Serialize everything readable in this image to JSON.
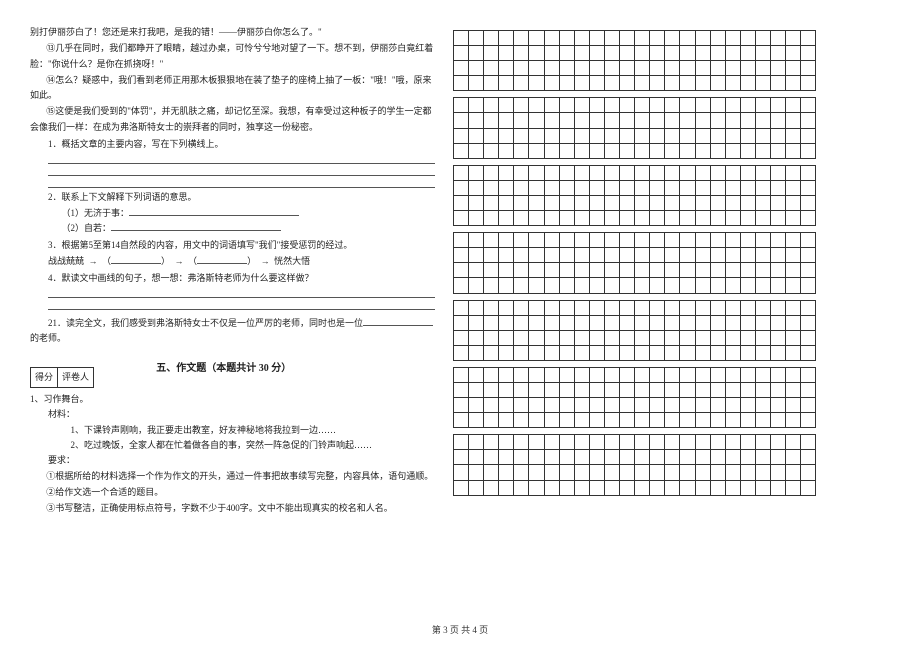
{
  "passage": {
    "p0": "别打伊丽莎白了！您还是来打我吧，是我的错！——伊丽莎白你怎么了。\"",
    "p1": "⑬几乎在同时，我们都睁开了眼睛，越过办桌，可怜兮兮地对望了一下。想不到，伊丽莎白竟红着脸：\"你说什么？是你在抓挠呀！\"",
    "p2": "⑭怎么？疑惑中，我们看到老师正用那木板狠狠地在装了垫子的座椅上抽了一板：\"哦！\"哦，原来如此。",
    "p3": "⑮这便是我们受到的\"体罚\"，并无肌肤之痛，却记忆至深。我想，有幸受过这种板子的学生一定都会像我们一样：在成为弗洛斯特女士的崇拜者的同时，独享这一份秘密。"
  },
  "questions": {
    "q1": "1．概括文章的主要内容，写在下列横线上。",
    "q2": "2．联系上下文解释下列词语的意思。",
    "q2a": "（1）无济于事：",
    "q2b": "（2）自若：",
    "q3": "3．根据第5至第14自然段的内容，用文中的词语填写\"我们\"接受惩罚的经过。",
    "q3_flow_a": "战战兢兢",
    "q3_flow_b": "恍然大悟",
    "arrow": "→",
    "lparen": "（",
    "rparen": "）",
    "q4": "4．默读文中画线的句子，想一想：弗洛斯特老师为什么要这样做？",
    "q21a": "21．读完全文，我们感受到弗洛斯特女士不仅是一位严厉的老师，同时也是一位",
    "q21b": "的老师。"
  },
  "section5": {
    "score_label": "得分",
    "reviewer_label": "评卷人",
    "title": "五、作文题（本题共计 30 分）",
    "prompt_label": "1、习作舞台。",
    "material_label": "材料：",
    "material1": "1、下课铃声刚响，我正要走出教室，好友神秘地将我拉到一边……",
    "material2": "2、吃过晚饭，全家人都在忙着做各自的事，突然一阵急促的门铃声响起……",
    "req_label": "要求：",
    "req1": "①根据所给的材料选择一个作为作文的开头，通过一件事把故事续写完整，内容具体，语句通顺。",
    "req2": "②给作文选一个合适的题目。",
    "req3": "③书写整洁，正确使用标点符号，字数不少于400字。文中不能出现真实的校名和人名。"
  },
  "grid": {
    "blocks": 7,
    "rows_per_block": 4,
    "cols": 24
  },
  "footer": "第 3 页 共 4 页"
}
